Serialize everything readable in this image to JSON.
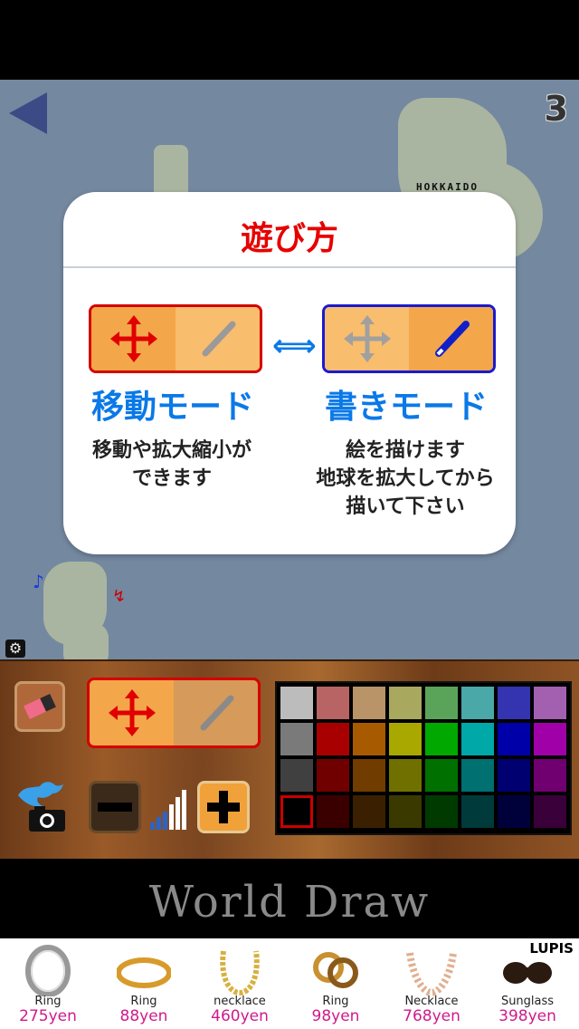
{
  "header": {
    "level": "3"
  },
  "map": {
    "place_label": "HOKKAIDO",
    "note_blue": "♪",
    "note_red": "↯"
  },
  "dialog": {
    "title": "遊び方",
    "move_mode_label": "移動モード",
    "draw_mode_label": "書きモード",
    "move_mode_desc": "移動や拡大縮小が\nできます",
    "draw_mode_desc": "絵を描けます\n地球を拡大してから\n描いて下さい"
  },
  "palette": {
    "rows": [
      [
        "#bcbcbc",
        "#b86464",
        "#b89468",
        "#a8a85e",
        "#5aa45a",
        "#4aa8a8",
        "#3434b0",
        "#a460b0"
      ],
      [
        "#7a7a7a",
        "#a80000",
        "#a85a00",
        "#a8a800",
        "#00a800",
        "#00a8a8",
        "#0000a8",
        "#a000a8"
      ],
      [
        "#404040",
        "#700000",
        "#703c00",
        "#707000",
        "#007000",
        "#007070",
        "#000070",
        "#700070"
      ],
      [
        "#000000",
        "#3a0000",
        "#3a2000",
        "#3a3a00",
        "#003a00",
        "#003a3a",
        "#00003a",
        "#3a003a"
      ]
    ],
    "selected_row": 3,
    "selected_col": 0
  },
  "app": {
    "title": "World Draw"
  },
  "ad": {
    "brand": "LUPIS",
    "items": [
      {
        "name": "Ring",
        "price": "275yen",
        "icon": "ring-icon"
      },
      {
        "name": "Ring",
        "price": "88yen",
        "icon": "gold-band-icon"
      },
      {
        "name": "necklace",
        "price": "460yen",
        "icon": "chain-necklace-icon"
      },
      {
        "name": "Ring",
        "price": "98yen",
        "icon": "knot-ring-icon"
      },
      {
        "name": "Necklace",
        "price": "768yen",
        "icon": "lace-necklace-icon"
      },
      {
        "name": "Sunglass",
        "price": "398yen",
        "icon": "sunglasses-icon"
      }
    ]
  }
}
